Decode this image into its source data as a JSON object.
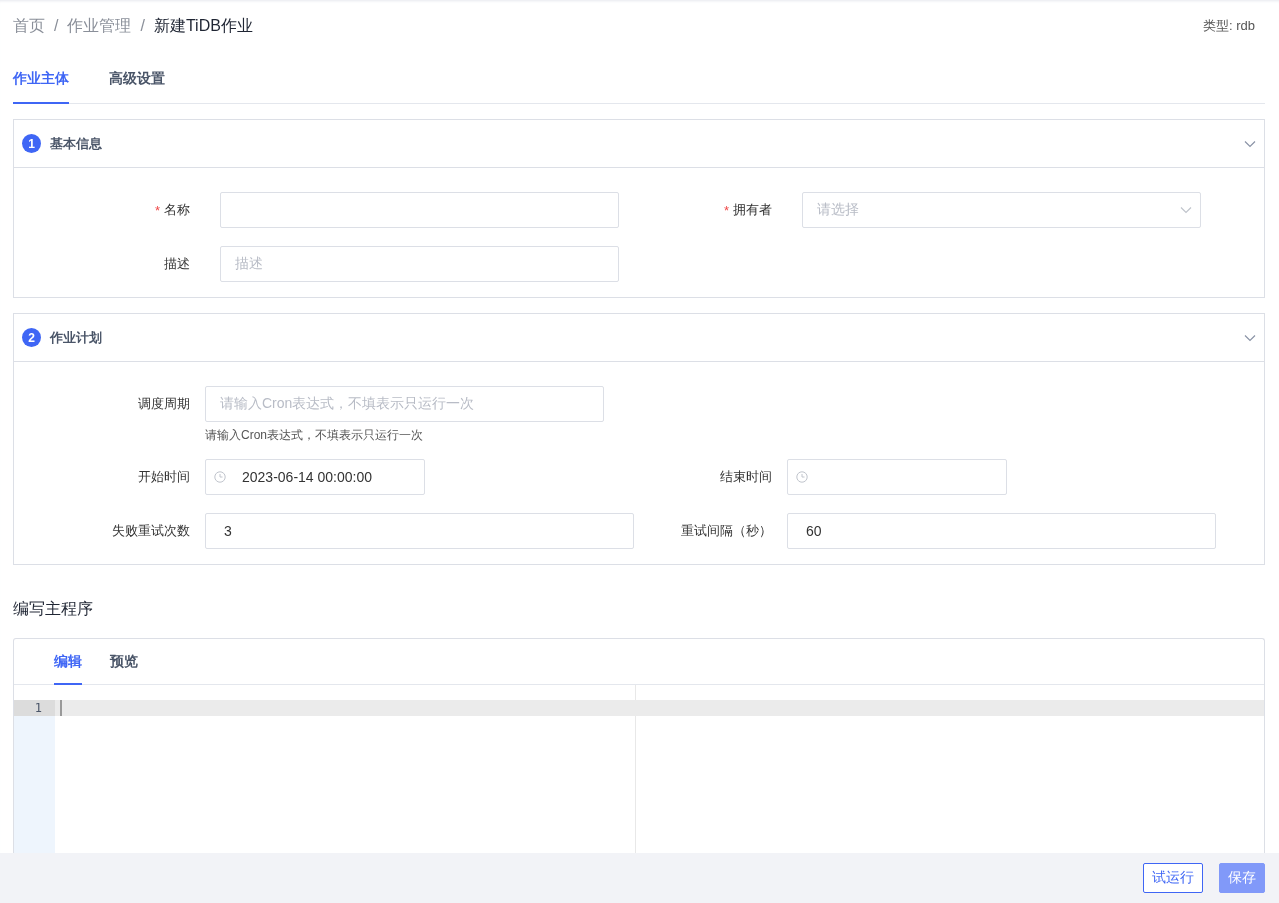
{
  "breadcrumb": [
    {
      "label": "首页",
      "current": false
    },
    {
      "label": "作业管理",
      "current": false
    },
    {
      "label": "新建TiDB作业",
      "current": true
    }
  ],
  "breadcrumb_separator": "/",
  "type_label": "类型: rdb",
  "tabs": [
    {
      "label": "作业主体",
      "selected": true
    },
    {
      "label": "高级设置",
      "selected": false
    }
  ],
  "required_mark": "*",
  "sections": [
    {
      "number": "1",
      "title": "基本信息",
      "expanded": true,
      "rows": [
        [
          {
            "label": "名称",
            "required": true,
            "kind": "text"
          },
          {
            "label": "拥有者",
            "required": true,
            "kind": "select",
            "placeholder": "请选择"
          }
        ],
        [
          {
            "label": "描述",
            "required": false,
            "kind": "text",
            "placeholder": "描述"
          }
        ]
      ]
    },
    {
      "number": "2",
      "title": "作业计划",
      "expanded": true,
      "rows": [
        [
          {
            "label": "调度周期",
            "required": false,
            "kind": "text",
            "placeholder": "请输入Cron表达式，不填表示只运行一次",
            "hint": "请输入Cron表达式，不填表示只运行一次"
          }
        ],
        [
          {
            "label": "开始时间",
            "required": false,
            "kind": "datetime",
            "value": "2023-06-14 00:00:00"
          },
          {
            "label": "结束时间",
            "required": false,
            "kind": "datetime"
          }
        ],
        [
          {
            "label": "失败重试次数",
            "required": false,
            "kind": "number",
            "value": "3"
          },
          {
            "label": "重试间隔（秒）",
            "required": false,
            "kind": "number",
            "value": "60"
          }
        ]
      ]
    }
  ],
  "program_title": "编写主程序",
  "editor": {
    "tabs": [
      {
        "label": "编辑",
        "selected": true
      },
      {
        "label": "预览",
        "selected": false
      }
    ],
    "line_numbers": [
      "1"
    ]
  },
  "footer_buttons": [
    {
      "label": "试运行",
      "kind": "outline"
    },
    {
      "label": "保存",
      "kind": "primary"
    }
  ]
}
